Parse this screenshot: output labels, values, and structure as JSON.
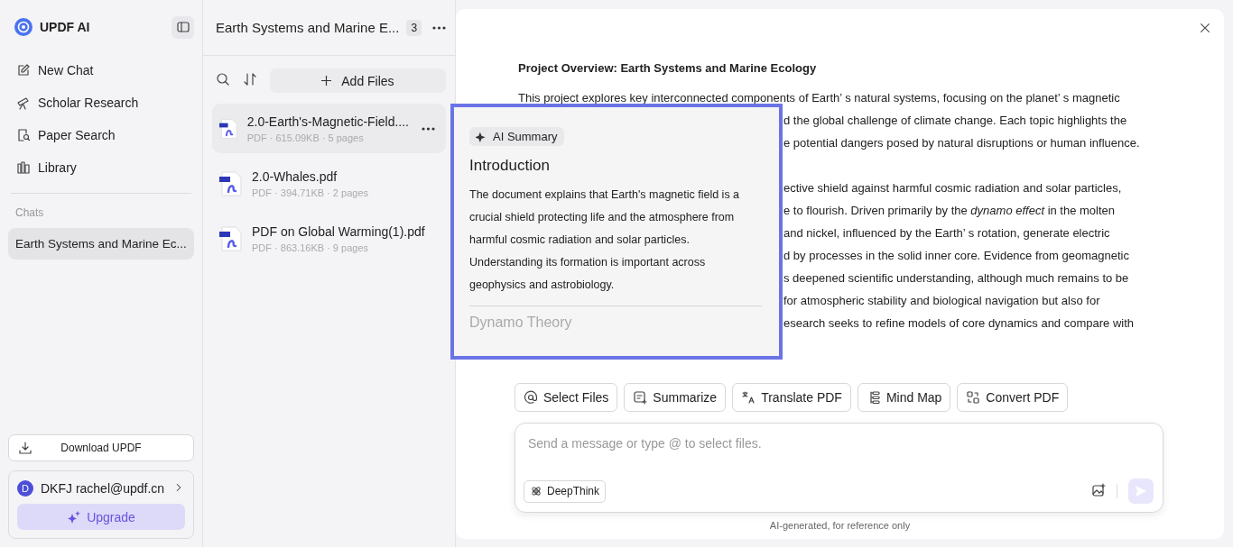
{
  "sidebar": {
    "brand": "UPDF AI",
    "nav": [
      {
        "label": "New Chat",
        "kind": "edit"
      },
      {
        "label": "Scholar Research",
        "kind": "telescope"
      },
      {
        "label": "Paper Search",
        "kind": "search-doc"
      },
      {
        "label": "Library",
        "kind": "books"
      }
    ],
    "section_label": "Chats",
    "chats": [
      {
        "label": "Earth Systems and Marine Ec...",
        "selected": true
      }
    ],
    "download_button": "Download UPDF",
    "account": {
      "avatar": "D",
      "name": "DKFJ rachel@updf.cn"
    },
    "upgrade_button": "Upgrade"
  },
  "files_panel": {
    "title": "Earth Systems and Marine E...",
    "count": "3",
    "add_button": "Add Files",
    "files": [
      {
        "name": "2.0-Earth's-Magnetic-Field....",
        "meta": "PDF · 615.09KB · 5 pages",
        "selected": true
      },
      {
        "name": "2.0-Whales.pdf",
        "meta": "PDF · 394.71KB · 2 pages",
        "selected": false
      },
      {
        "name": "PDF on Global Warming(1).pdf",
        "meta": "PDF · 863.16KB · 9 pages",
        "selected": false
      }
    ]
  },
  "document": {
    "title": "Project Overview: Earth Systems and Marine Ecology",
    "first_line": "This project explores key interconnected components of Earth’ s natural systems, focusing on the planet’ s magnetic",
    "visible_fragments": [
      [
        "d the global challenge of climate change. Each topic highlights the",
        "e potential dangers posed by natural disruptions or human influence."
      ],
      [
        "ective shield against harmful cosmic radiation and solar particles,",
        "e to flourish. Driven primarily by the *dynamo effect* in the molten",
        "and nickel, influenced by the Earth’ s rotation, generate electric",
        "d by processes in the solid inner core. Evidence from geomagnetic",
        "s deepened scientific understanding, although much remains to be",
        "for atmospheric stability and biological navigation but also for",
        "esearch seeks to refine models of core dynamics and compare with"
      ]
    ]
  },
  "summary_popup": {
    "badge": "AI Summary",
    "heading": "Introduction",
    "body": "The document explains that Earth's magnetic field is a crucial shield protecting life and the atmosphere from harmful cosmic radiation and solar particles. Understanding its formation is important across geophysics and astrobiology.",
    "next_heading": "Dynamo Theory"
  },
  "actions": [
    {
      "label": "Select Files",
      "kind": "at"
    },
    {
      "label": "Summarize",
      "kind": "summarize"
    },
    {
      "label": "Translate PDF",
      "kind": "translate"
    },
    {
      "label": "Mind Map",
      "kind": "mindmap"
    },
    {
      "label": "Convert PDF",
      "kind": "convert"
    }
  ],
  "composer": {
    "placeholder": "Send a message or type @ to select files.",
    "deepthink_button": "DeepThink"
  },
  "footer_note": "AI-generated, for reference only"
}
